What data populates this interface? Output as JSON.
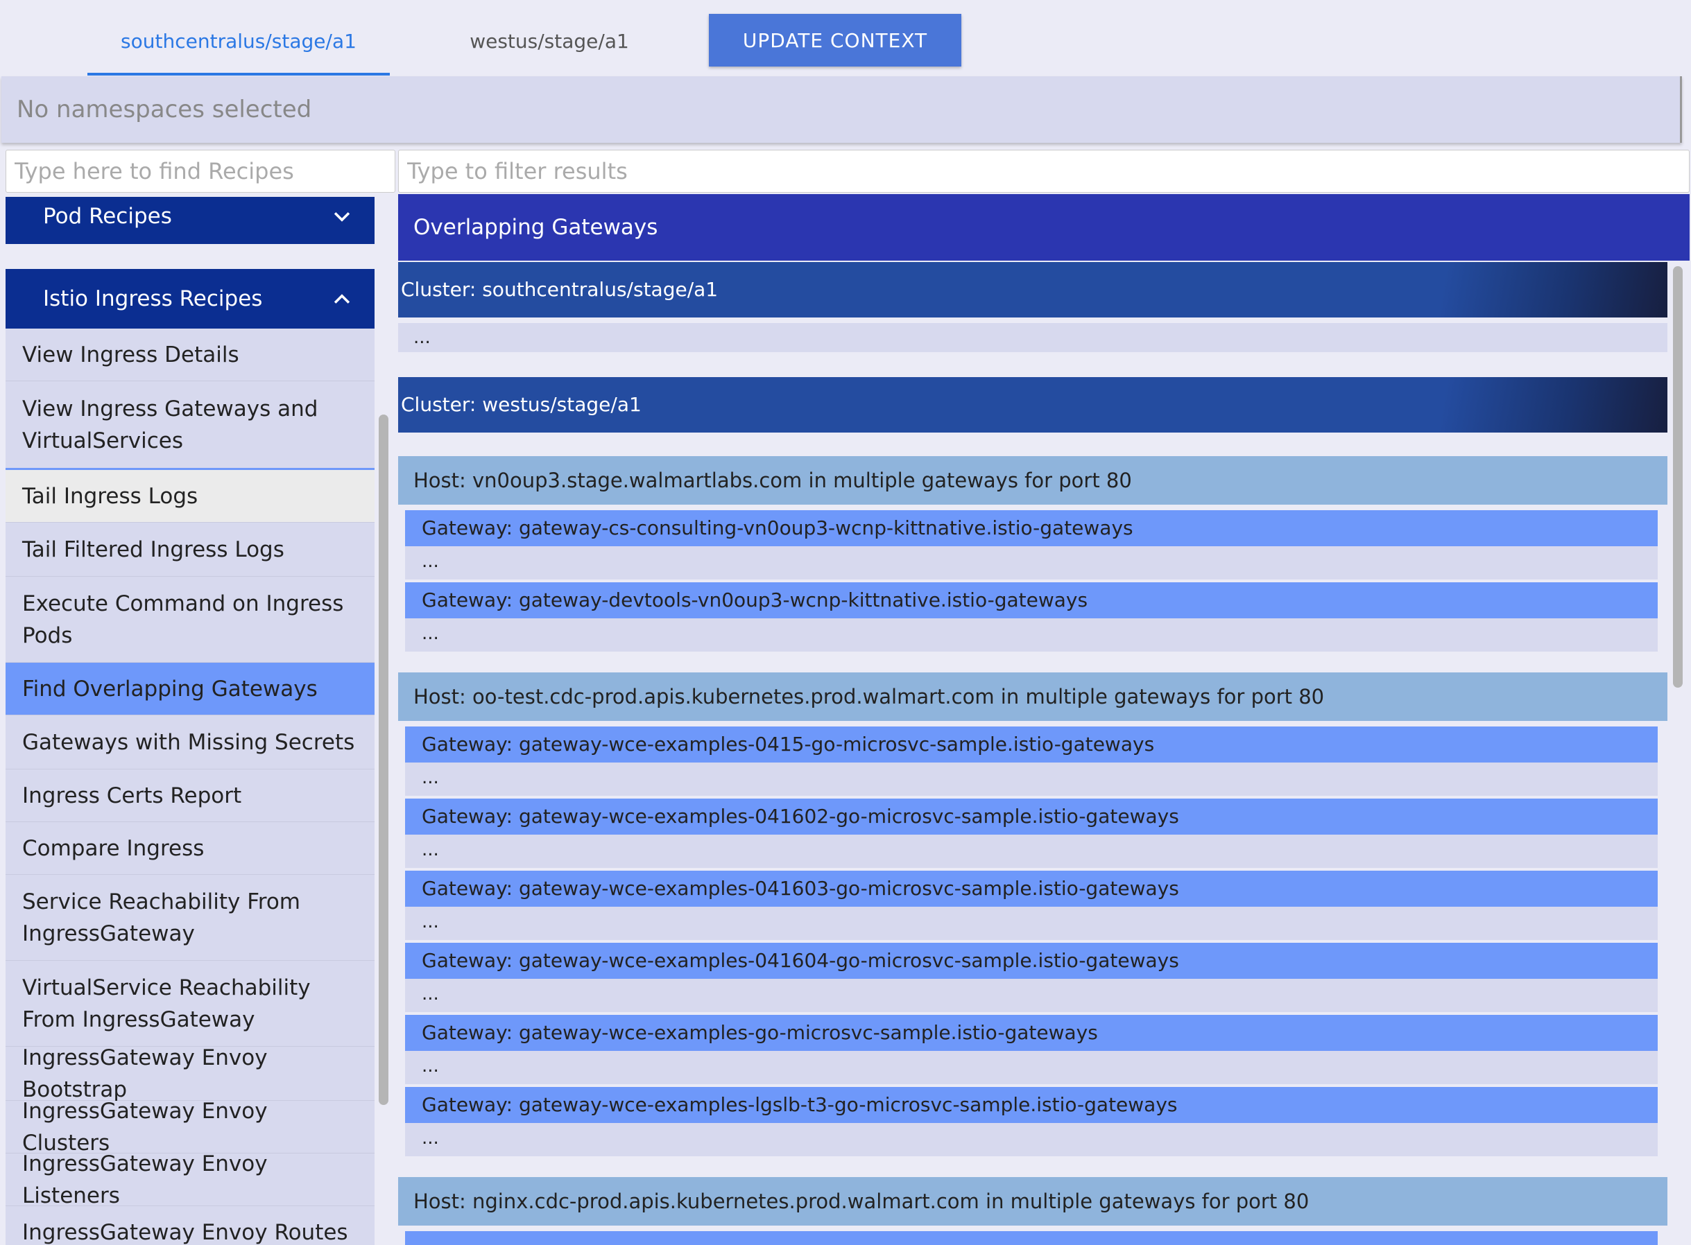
{
  "tabs": [
    {
      "label": "southcentralus/stage/a1"
    },
    {
      "label": "westus/stage/a1"
    }
  ],
  "update_button": "UPDATE CONTEXT",
  "namespace_text": "No namespaces selected",
  "recipe_search_placeholder": "Type here to find Recipes",
  "filter_placeholder": "Type to filter results",
  "sidebar": {
    "pod_recipes": "Pod Recipes",
    "istio_recipes": "Istio Ingress Recipes",
    "items": [
      "View Ingress Details",
      "View Ingress Gateways and VirtualServices",
      "Tail Ingress Logs",
      "Tail Filtered Ingress Logs",
      "Execute Command on Ingress Pods",
      "Find Overlapping Gateways",
      "Gateways with Missing Secrets",
      "Ingress Certs Report",
      "Compare Ingress",
      "Service Reachability From IngressGateway",
      "VirtualService Reachability From IngressGateway",
      "IngressGateway Envoy Bootstrap",
      "IngressGateway Envoy Clusters",
      "IngressGateway Envoy Listeners",
      "IngressGateway Envoy Routes"
    ]
  },
  "results": {
    "title": "Overlapping Gateways",
    "cluster1": "Cluster: southcentralus/stage/a1",
    "cluster2": "Cluster: westus/stage/a1",
    "ellipsis": "...",
    "host1": "Host: vn0oup3.stage.walmartlabs.com in multiple gateways for port 80",
    "host1_gateways": [
      "Gateway: gateway-cs-consulting-vn0oup3-wcnp-kittnative.istio-gateways",
      "Gateway: gateway-devtools-vn0oup3-wcnp-kittnative.istio-gateways"
    ],
    "host2": "Host: oo-test.cdc-prod.apis.kubernetes.prod.walmart.com in multiple gateways for port 80",
    "host2_gateways": [
      "Gateway: gateway-wce-examples-0415-go-microsvc-sample.istio-gateways",
      "Gateway: gateway-wce-examples-041602-go-microsvc-sample.istio-gateways",
      "Gateway: gateway-wce-examples-041603-go-microsvc-sample.istio-gateways",
      "Gateway: gateway-wce-examples-041604-go-microsvc-sample.istio-gateways",
      "Gateway: gateway-wce-examples-go-microsvc-sample.istio-gateways",
      "Gateway: gateway-wce-examples-lgslb-t3-go-microsvc-sample.istio-gateways"
    ],
    "host3": "Host: nginx.cdc-prod.apis.kubernetes.prod.walmart.com in multiple gateways for port 80"
  }
}
